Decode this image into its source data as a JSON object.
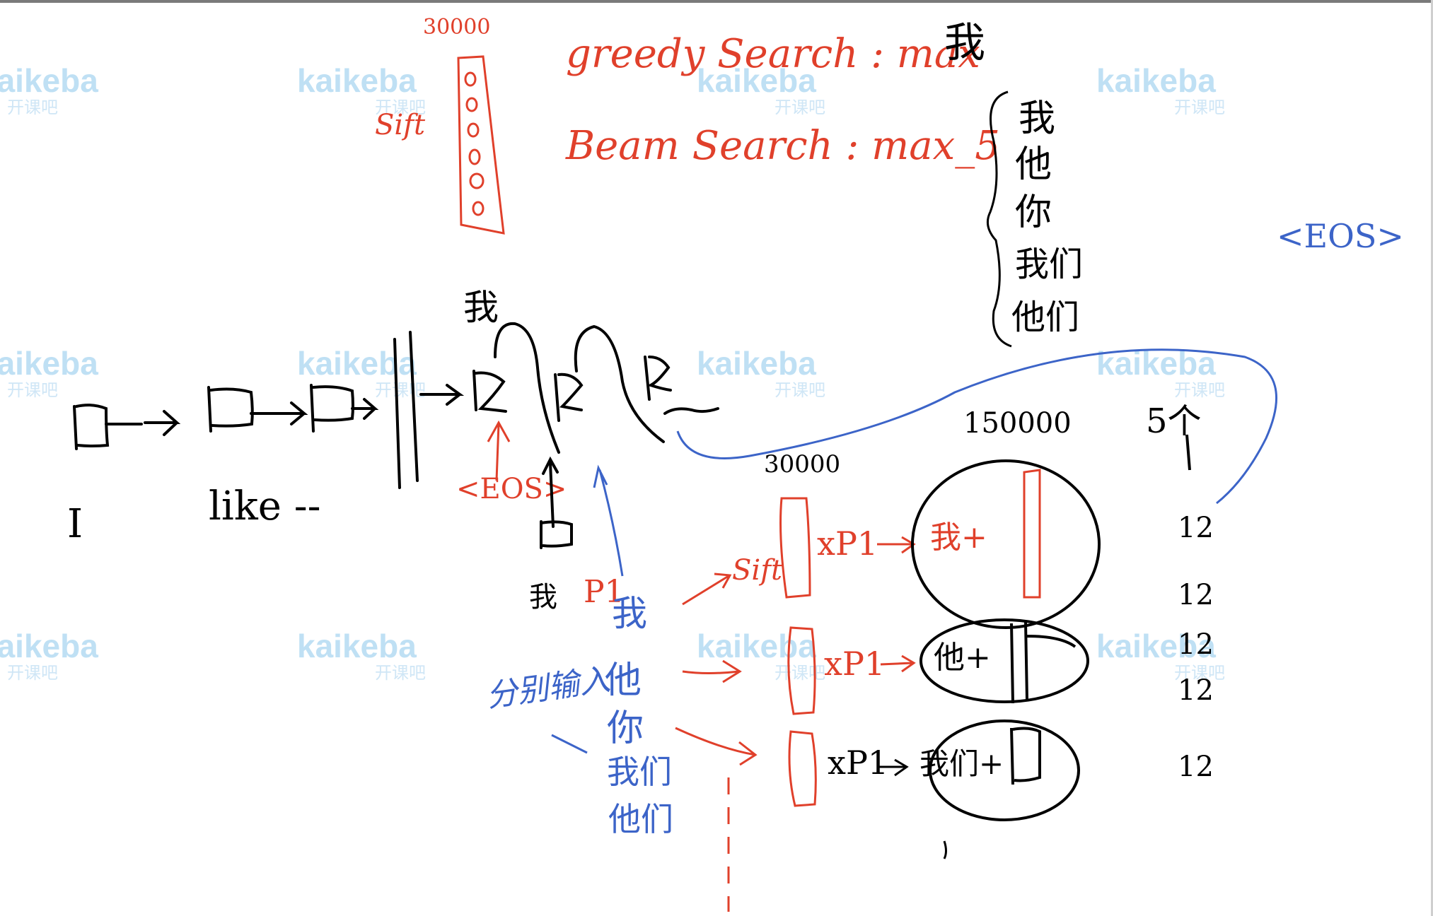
{
  "watermark": {
    "brand": "kaikeba",
    "sub": "开课吧"
  },
  "vocab_top": {
    "size": "30000",
    "label": "Sift"
  },
  "search": {
    "greedy_label": "greedy Search : max",
    "greedy_word": "我",
    "beam_label": "Beam Search : max_5",
    "candidates": [
      "我",
      "他",
      "你",
      "我们",
      "他们"
    ]
  },
  "eos_tag": "<EOS>",
  "decoder": {
    "input_labels": [
      "I",
      "like --"
    ],
    "output_word": "我",
    "start_token": "<EOS>",
    "prev_word": "我",
    "prob_label": "P1",
    "blue_column": [
      "我",
      "他",
      "你",
      "我们",
      "他们"
    ],
    "blue_note": "分别输入"
  },
  "beam": {
    "vocab_size": "30000",
    "big_size": "150000",
    "count_label": "5个",
    "sift_label": "Sift",
    "rows": [
      {
        "mult": "xP1",
        "word": "我+"
      },
      {
        "mult": "xP1",
        "word": "他+"
      },
      {
        "mult": "xP1",
        "word": "我们+"
      }
    ],
    "right_cells": [
      "12",
      "12",
      "12",
      "12",
      "12"
    ]
  },
  "colors": {
    "red": "#e0402b",
    "blue": "#3c64c8",
    "ink": "#000000",
    "watermark": "#bfe0f4"
  }
}
